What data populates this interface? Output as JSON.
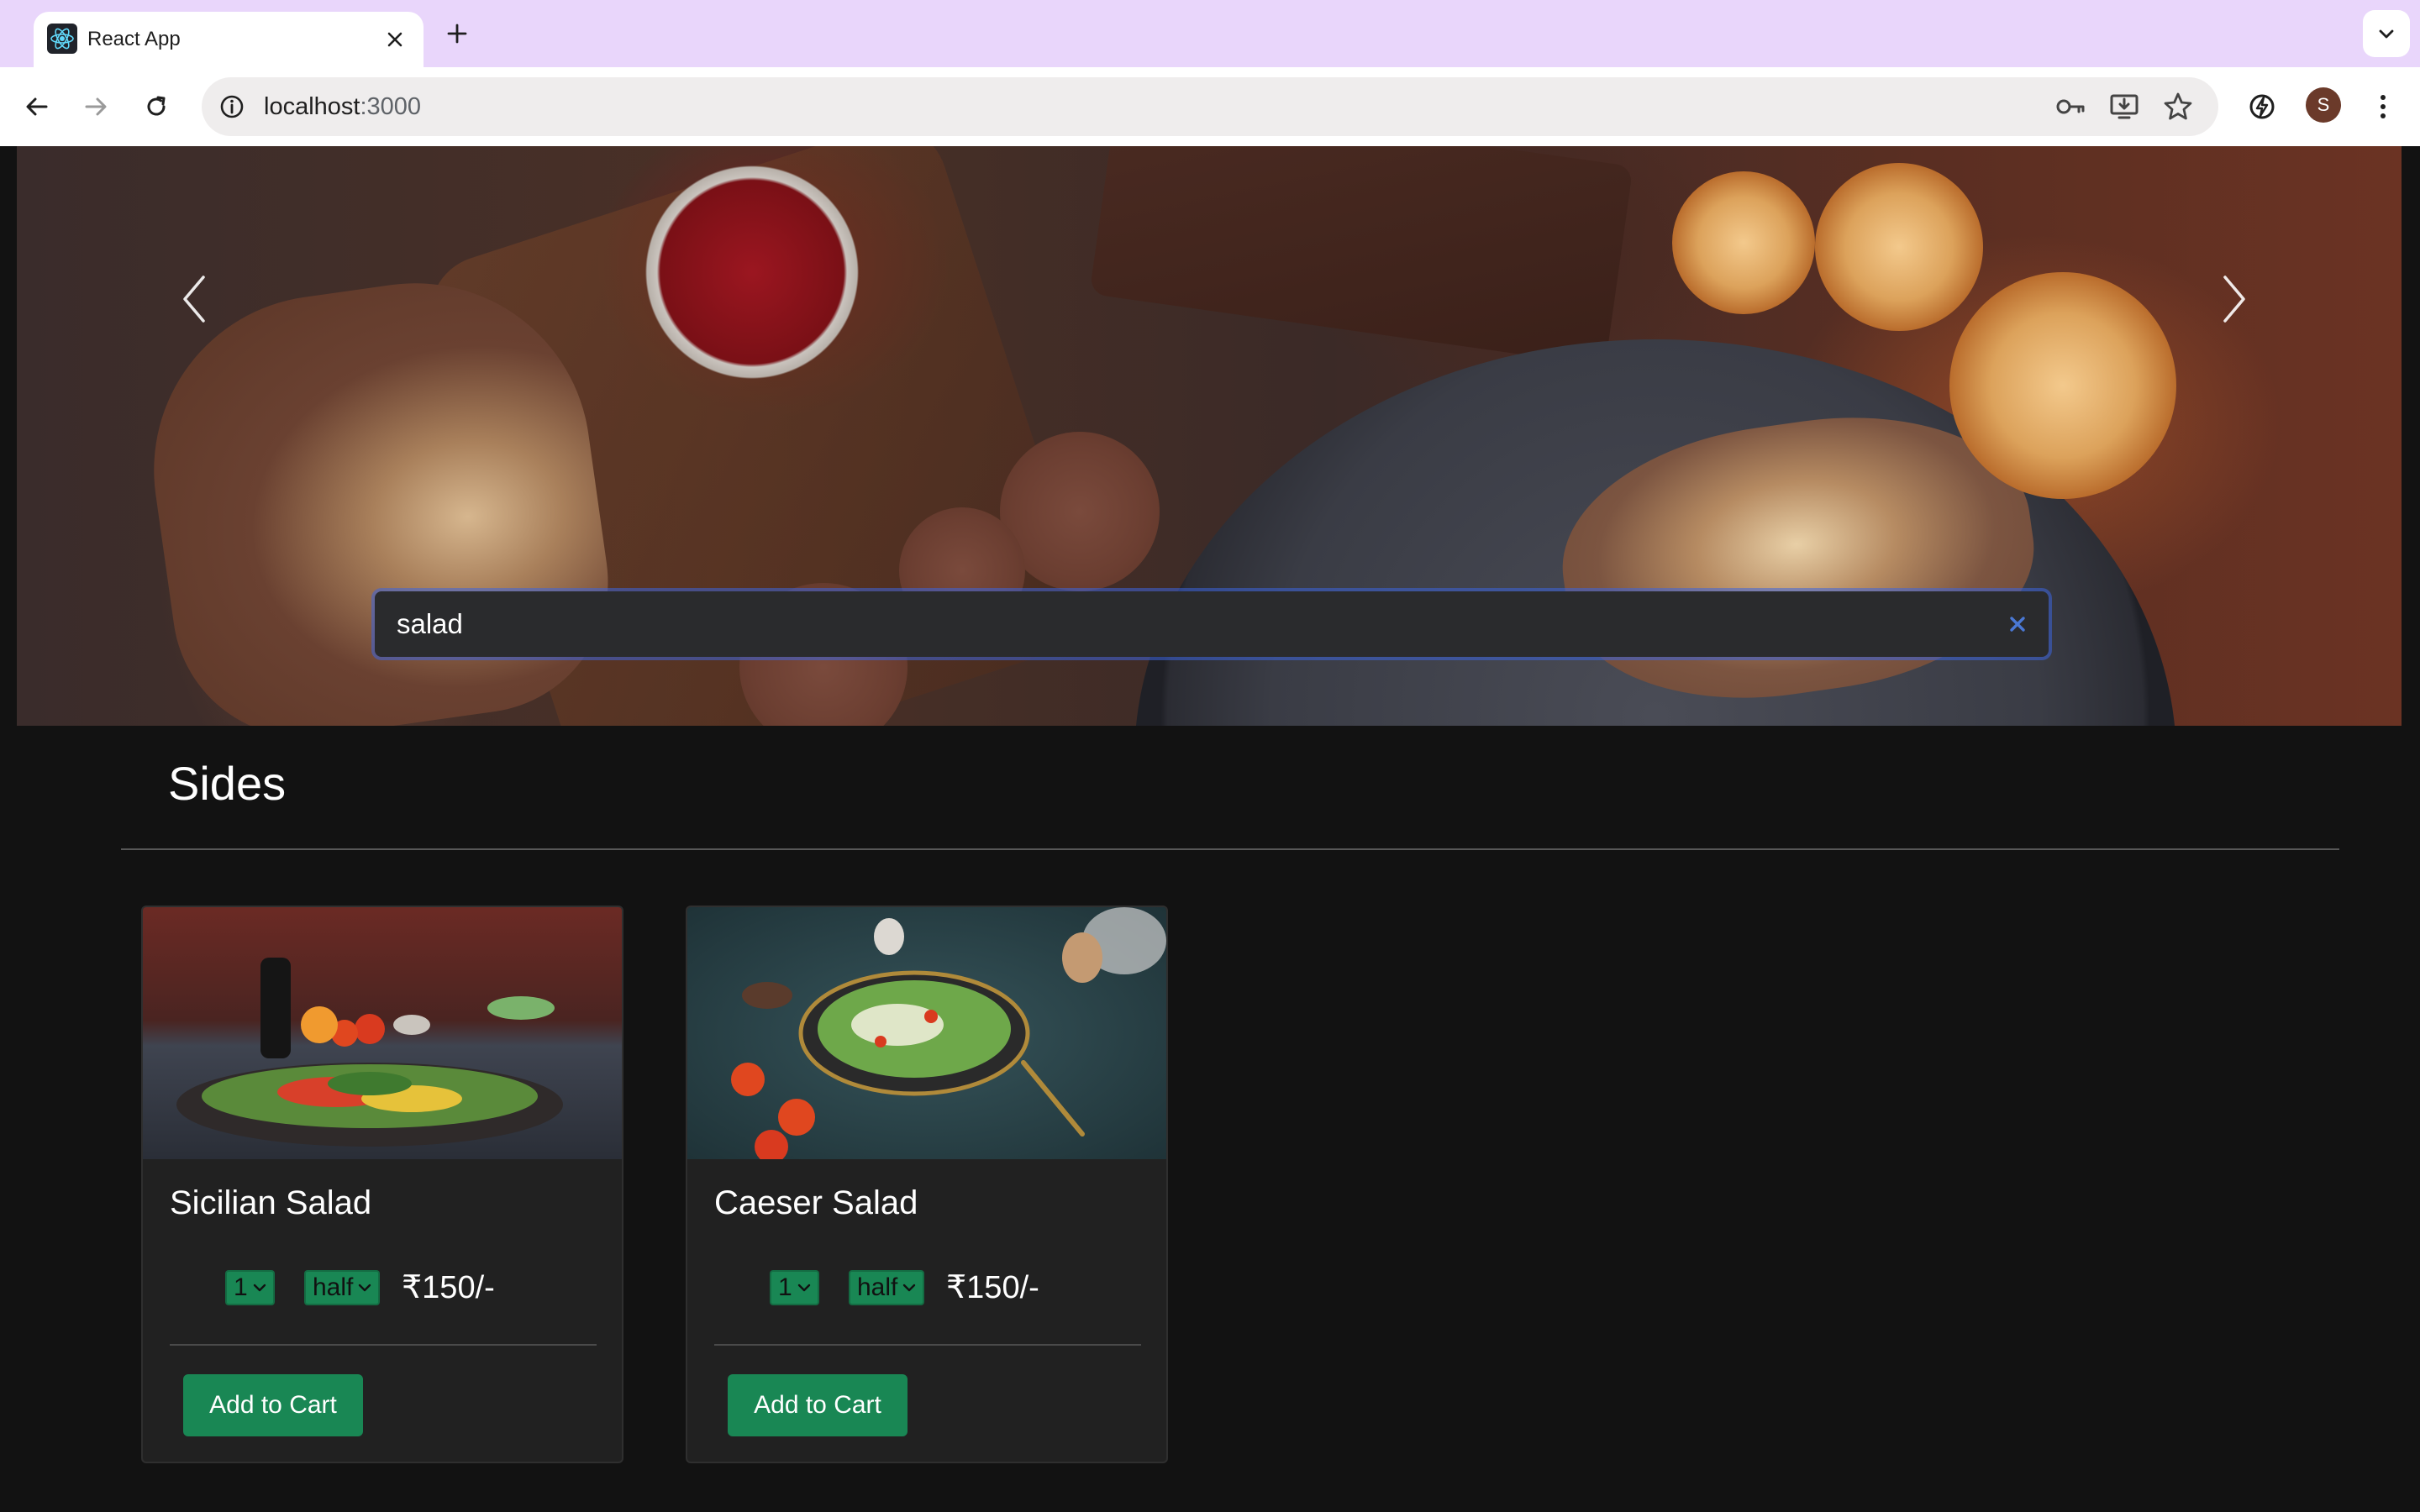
{
  "browser": {
    "tab_title": "React App",
    "url_host": "localhost",
    "url_port": ":3000",
    "avatar_initial": "S",
    "icons": {
      "favicon": "react-logo-icon",
      "tab_close": "close-icon",
      "new_tab": "plus-icon",
      "tab_search": "chevron-down-icon",
      "back": "arrow-left-icon",
      "forward": "arrow-right-icon",
      "reload": "reload-icon",
      "site_info": "info-icon",
      "password": "key-icon",
      "install": "install-icon",
      "bookmark": "star-icon",
      "extension": "lightning-icon",
      "menu": "kebab-menu-icon"
    }
  },
  "hero": {
    "search_value": "salad",
    "icons": {
      "prev": "chevron-left-icon",
      "next": "chevron-right-icon",
      "clear": "clear-x-icon"
    }
  },
  "section": {
    "title": "Sides"
  },
  "cards": [
    {
      "title": "Sicilian Salad",
      "qty": "1",
      "size": "half",
      "price": "₹150/-",
      "button": "Add to Cart"
    },
    {
      "title": "Caeser Salad",
      "qty": "1",
      "size": "half",
      "price": "₹150/-",
      "button": "Add to Cart"
    }
  ],
  "colors": {
    "tabstrip": "#e9d6fb",
    "page_bg": "#121212",
    "card_bg": "#212121",
    "accent_green": "#198754",
    "search_focus": "#3c64dc"
  }
}
